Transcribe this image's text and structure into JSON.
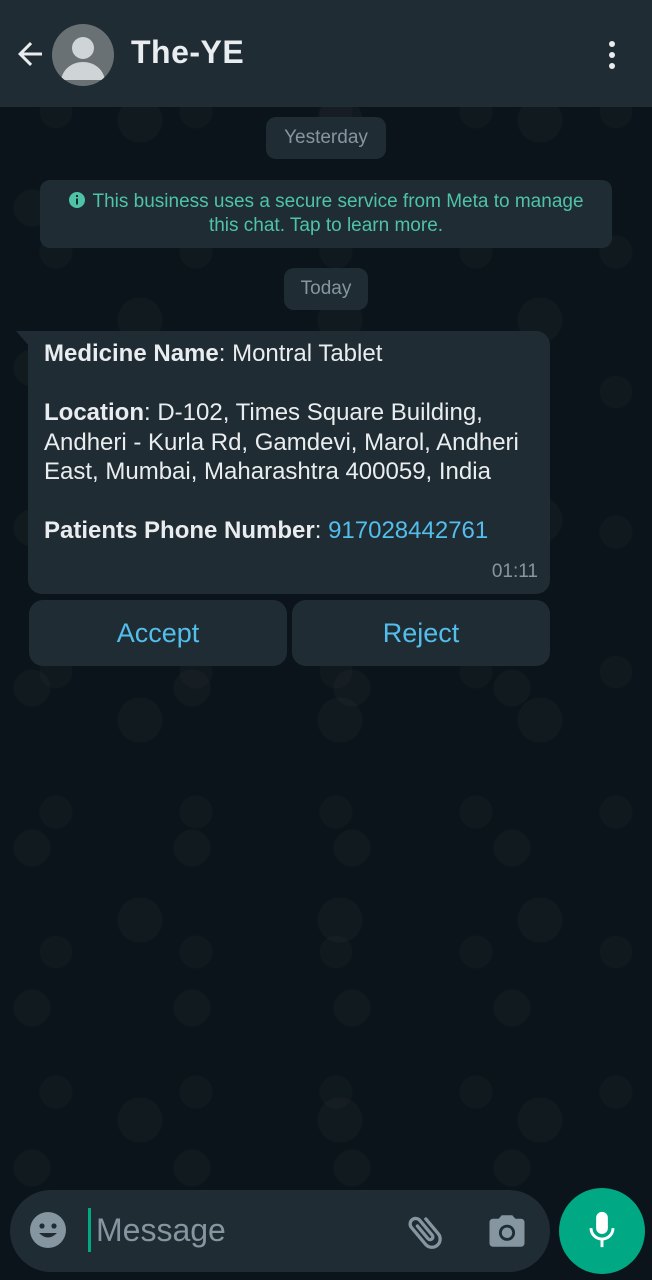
{
  "header": {
    "title": "The-YE",
    "back_icon": "arrow-left-icon",
    "menu_icon": "more-vertical-icon"
  },
  "chat": {
    "date_yesterday": "Yesterday",
    "notice": "This business uses a secure service from Meta to manage this chat. Tap to learn more.",
    "date_today": "Today"
  },
  "message": {
    "medicine_label": "Medicine Name",
    "medicine_value": ": Montral Tablet",
    "location_label": "Location",
    "location_value": ": D-102, Times Square Building, Andheri - Kurla Rd, Gamdevi, Marol, Andheri East, Mumbai, Maharashtra 400059, India",
    "phone_label": "Patients Phone Number",
    "phone_sep": ": ",
    "phone_value": "917028442761",
    "time": "01:11"
  },
  "actions": {
    "accept": "Accept",
    "reject": "Reject"
  },
  "composer": {
    "placeholder": "Message"
  },
  "colors": {
    "accent": "#00a884",
    "link": "#53bdeb",
    "bubble": "#202c33",
    "header": "#1f2c34"
  }
}
